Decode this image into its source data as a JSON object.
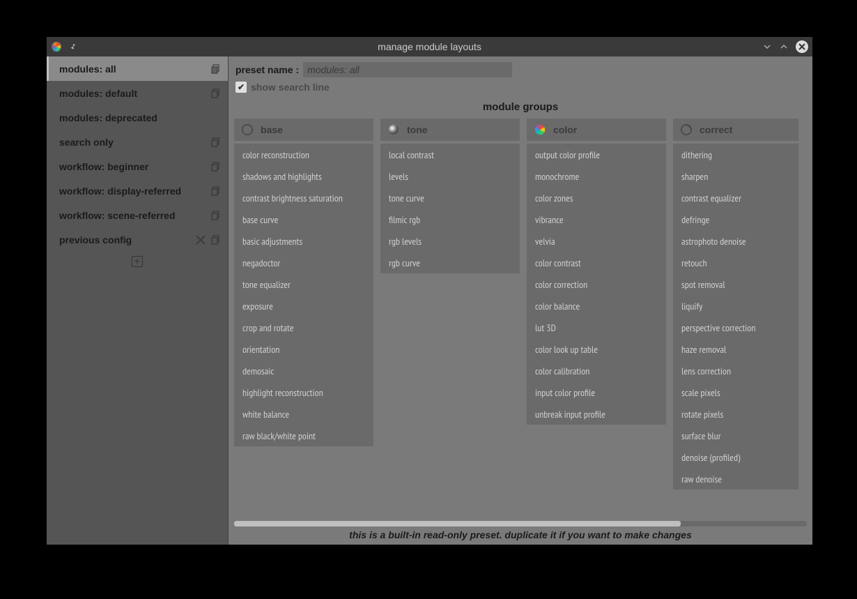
{
  "window": {
    "title": "manage module layouts"
  },
  "sidebar": {
    "presets": [
      {
        "label": "modules: all",
        "selected": true,
        "copy": true,
        "delete": false
      },
      {
        "label": "modules: default",
        "selected": false,
        "copy": true,
        "delete": false
      },
      {
        "label": "modules: deprecated",
        "selected": false,
        "copy": false,
        "delete": false
      },
      {
        "label": "search only",
        "selected": false,
        "copy": true,
        "delete": false
      },
      {
        "label": "workflow: beginner",
        "selected": false,
        "copy": true,
        "delete": false
      },
      {
        "label": "workflow: display-referred",
        "selected": false,
        "copy": true,
        "delete": false
      },
      {
        "label": "workflow: scene-referred",
        "selected": false,
        "copy": true,
        "delete": false
      },
      {
        "label": "previous config",
        "selected": false,
        "copy": true,
        "delete": true
      }
    ]
  },
  "form": {
    "preset_name_label": "preset name :",
    "preset_name_value": "modules: all",
    "show_search_checked": true,
    "show_search_label": "show search line"
  },
  "groups_title": "module groups",
  "groups": [
    {
      "icon": "circle-outline",
      "label": "base",
      "modules": [
        "color reconstruction",
        "shadows and highlights",
        "contrast brightness saturation",
        "base curve",
        "basic adjustments",
        "negadoctor",
        "tone equalizer",
        "exposure",
        "crop and rotate",
        "orientation",
        "demosaic",
        "highlight reconstruction",
        "white balance",
        "raw black/white point"
      ]
    },
    {
      "icon": "gradient-sphere",
      "label": "tone",
      "modules": [
        "local contrast",
        "levels",
        "tone curve",
        "filmic rgb",
        "rgb levels",
        "rgb curve"
      ]
    },
    {
      "icon": "color-wheel",
      "label": "color",
      "modules": [
        "output color profile",
        "monochrome",
        "color zones",
        "vibrance",
        "velvia",
        "color contrast",
        "color correction",
        "color balance",
        "lut 3D",
        "color look up table",
        "color calibration",
        "input color profile",
        "unbreak input profile"
      ]
    },
    {
      "icon": "swirl-outline",
      "label": "correct",
      "modules": [
        "dithering",
        "sharpen",
        "contrast equalizer",
        "defringe",
        "astrophoto denoise",
        "retouch",
        "spot removal",
        "liquify",
        "perspective correction",
        "haze removal",
        "lens correction",
        "scale pixels",
        "rotate pixels",
        "surface blur",
        "denoise (profiled)",
        "raw denoise"
      ]
    }
  ],
  "footer_note": "this is a built-in read-only preset. duplicate it if you want to make changes"
}
